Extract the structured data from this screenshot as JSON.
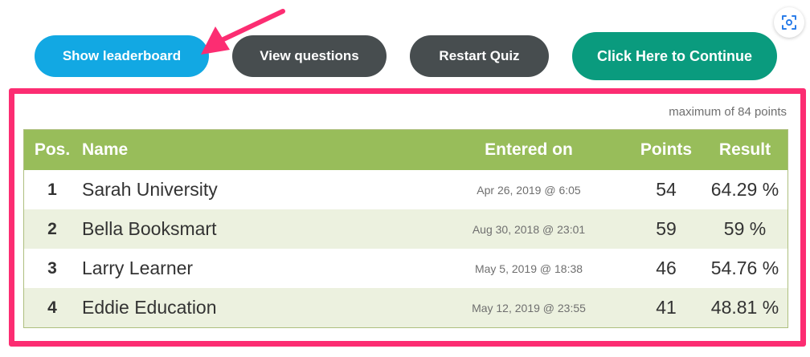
{
  "toolbar": {
    "show_leaderboard": "Show leaderboard",
    "view_questions": "View questions",
    "restart_quiz": "Restart Quiz",
    "continue": "Click Here to Continue"
  },
  "screen_capture_icon": "scan-icon",
  "leaderboard": {
    "max_points_note": "maximum of 84 points",
    "headers": {
      "pos": "Pos.",
      "name": "Name",
      "entered_on": "Entered on",
      "points": "Points",
      "result": "Result"
    },
    "rows": [
      {
        "pos": "1",
        "name": "Sarah University",
        "entered_on": "Apr 26, 2019 @ 6:05",
        "points": "54",
        "result": "64.29 %"
      },
      {
        "pos": "2",
        "name": "Bella Booksmart",
        "entered_on": "Aug 30, 2018 @ 23:01",
        "points": "59",
        "result": "59 %"
      },
      {
        "pos": "3",
        "name": "Larry Learner",
        "entered_on": "May 5, 2019 @ 18:38",
        "points": "46",
        "result": "54.76 %"
      },
      {
        "pos": "4",
        "name": "Eddie Education",
        "entered_on": "May 12, 2019 @ 23:55",
        "points": "41",
        "result": "48.81 %"
      }
    ]
  },
  "colors": {
    "blue_button": "#12a8e3",
    "dark_button": "#474d4f",
    "green_button": "#0a9b7e",
    "annotation_pink": "#fc2d72",
    "table_header": "#98bd5a",
    "alt_row": "#ecf1df"
  }
}
